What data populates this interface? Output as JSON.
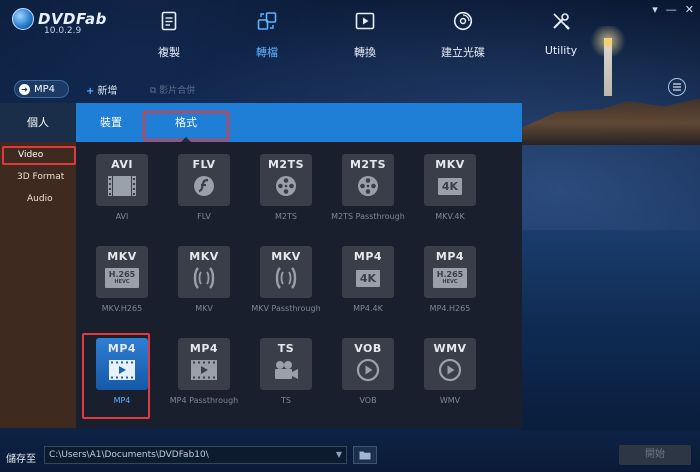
{
  "app": {
    "logo_text": "DVDFab",
    "version": "10.0.2.9",
    "accent": "#1f7ed6",
    "highlight_color": "#e0393e"
  },
  "nav": {
    "items": [
      {
        "label": "複製",
        "icon": "copy-icon"
      },
      {
        "label": "轉檔",
        "icon": "convert-icon"
      },
      {
        "label": "轉換",
        "icon": "video-player-icon"
      },
      {
        "label": "建立光碟",
        "icon": "disc-icon"
      },
      {
        "label": "Utility",
        "icon": "tools-icon"
      }
    ],
    "active_index": 1
  },
  "window_controls": [
    "▾",
    "—",
    "✕"
  ],
  "toolbar": {
    "profile": "MP4",
    "add": "新增",
    "merge": "影片合併"
  },
  "panel": {
    "tabs": {
      "personal": "個人",
      "device": "裝置",
      "format": "格式"
    },
    "sidebar": [
      "Video",
      "3D Format",
      "Audio"
    ],
    "formats": [
      {
        "code": "AVI",
        "label": "AVI",
        "glyph": "film-strip-icon"
      },
      {
        "code": "FLV",
        "label": "FLV",
        "glyph": "flash-icon"
      },
      {
        "code": "M2TS",
        "label": "M2TS",
        "glyph": "film-reel-icon"
      },
      {
        "code": "M2TS",
        "label": "M2TS Passthrough",
        "glyph": "film-reel-icon"
      },
      {
        "code": "MKV",
        "label": "MKV.4K",
        "glyph": "4k-badge-icon",
        "badge": "4K"
      },
      {
        "code": "MKV",
        "label": "MKV.H265",
        "glyph": "h265-badge-icon",
        "badge": "H.265",
        "sub": "HEVC"
      },
      {
        "code": "MKV",
        "label": "MKV",
        "glyph": "matroska-icon"
      },
      {
        "code": "MKV",
        "label": "MKV Passthrough",
        "glyph": "matroska-icon"
      },
      {
        "code": "MP4",
        "label": "MP4.4K",
        "glyph": "4k-badge-icon",
        "badge": "4K"
      },
      {
        "code": "MP4",
        "label": "MP4.H265",
        "glyph": "h265-badge-icon",
        "badge": "H.265",
        "sub": "HEVC"
      },
      {
        "code": "MP4",
        "label": "MP4",
        "glyph": "play-film-icon"
      },
      {
        "code": "MP4",
        "label": "MP4 Passthrough",
        "glyph": "play-film-icon"
      },
      {
        "code": "TS",
        "label": "TS",
        "glyph": "camera-icon"
      },
      {
        "code": "VOB",
        "label": "VOB",
        "glyph": "play-circle-icon"
      },
      {
        "code": "WMV",
        "label": "WMV",
        "glyph": "play-circle-icon"
      }
    ],
    "selected_format": "MP4"
  },
  "bottom": {
    "save_label": "儲存至",
    "path": "C:\\Users\\A1\\Documents\\DVDFab10\\",
    "start": "開始"
  }
}
